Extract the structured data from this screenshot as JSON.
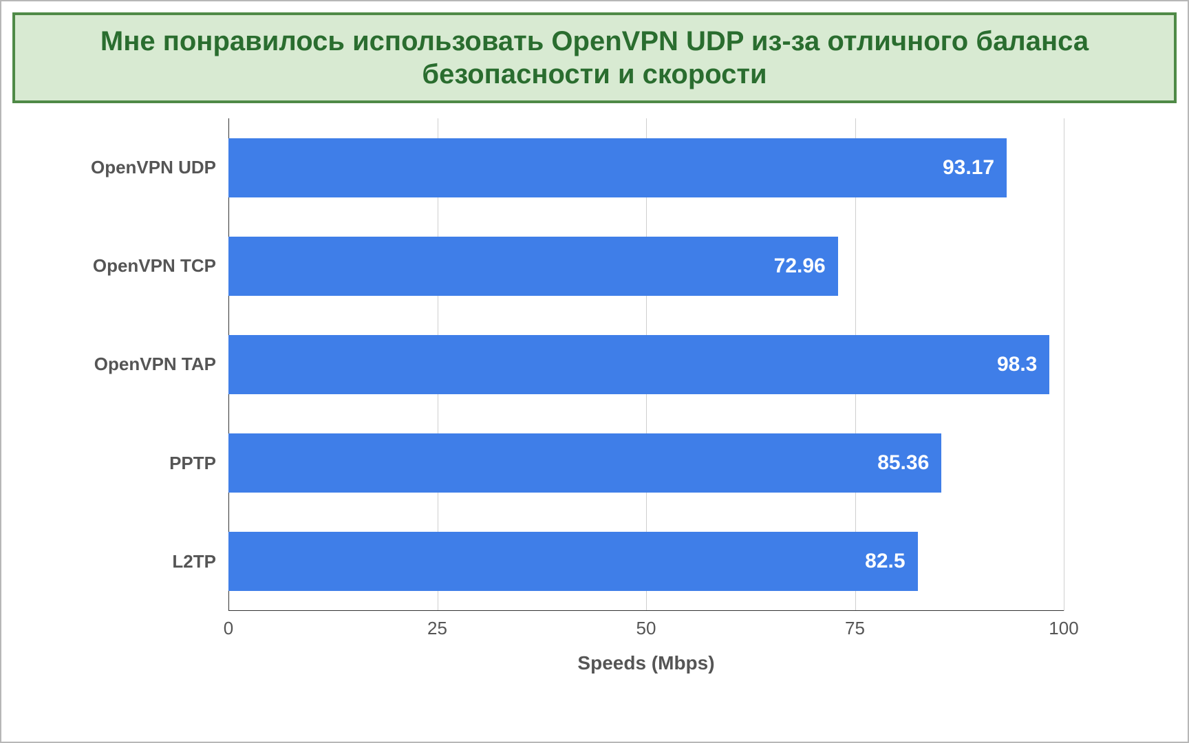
{
  "title": "Мне понравилось использовать OpenVPN UDP из-за отличного баланса безопасности и скорости",
  "chart_data": {
    "type": "bar",
    "orientation": "horizontal",
    "categories": [
      "OpenVPN UDP",
      "OpenVPN TCP",
      "OpenVPN TAP",
      "PPTP",
      "L2TP"
    ],
    "values": [
      93.17,
      72.96,
      98.3,
      85.36,
      82.5
    ],
    "xlabel": "Speeds (Mbps)",
    "ylabel": "",
    "xlim": [
      0,
      100
    ],
    "xticks": [
      0,
      25,
      50,
      75,
      100
    ],
    "bar_color": "#3f7ee8",
    "title_bg": "#d8ead2",
    "title_border": "#4f8a47",
    "title_color": "#2a6d2f"
  }
}
